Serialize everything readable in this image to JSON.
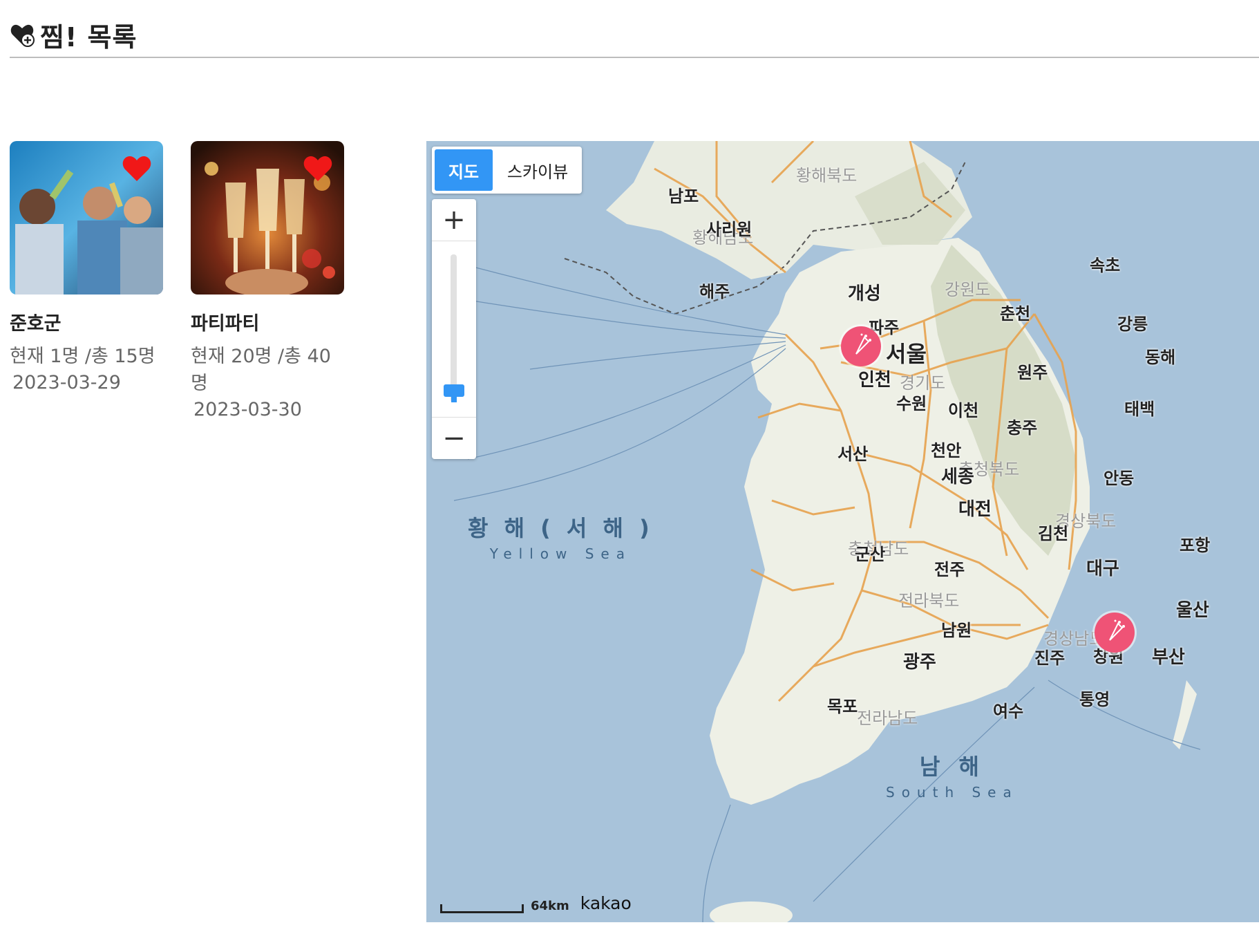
{
  "header": {
    "title": "찜! 목록"
  },
  "favorites": [
    {
      "name": "준호군",
      "count": "현재 1명 /총 15명",
      "date": "2023-03-29"
    },
    {
      "name": "파티파티",
      "count": "현재 20명 /총 40명",
      "date": "2023-03-30"
    }
  ],
  "map": {
    "type_map_label": "지도",
    "type_sky_label": "스카이뷰",
    "zoom_in_label": "+",
    "zoom_out_label": "−",
    "scale_label": "64km",
    "provider_label": "kakao",
    "sea_west": "황 해 ( 서 해 )",
    "sea_west_en": "Yellow Sea",
    "sea_south": "남 해",
    "sea_south_en": "South Sea",
    "cities": {
      "seoul": "서울",
      "incheon": "인천",
      "suwon": "수원",
      "icheon": "이천",
      "gaeseong": "개성",
      "paju": "파주",
      "chuncheon": "춘천",
      "gangneung": "강릉",
      "sokcho": "속초",
      "donghae": "동해",
      "wonju": "원주",
      "chungju": "충주",
      "cheonan": "천안",
      "sejong": "세종",
      "daejeon": "대전",
      "seosan": "서산",
      "gunsan": "군산",
      "jeonju": "전주",
      "gwangju": "광주",
      "mokpo": "목포",
      "yeosu": "여수",
      "namwon": "남원",
      "jinju": "진주",
      "changwon": "창원",
      "busan": "부산",
      "ulsan": "울산",
      "daegu": "대구",
      "pohang": "포항",
      "gimcheon": "김천",
      "andong": "안동",
      "taebaek": "태백",
      "tongyeong": "통영",
      "haeju": "해주",
      "sariwon": "사리원",
      "nampo": "남포"
    },
    "provinces": {
      "gyeonggi": "경기도",
      "gangwon": "강원도",
      "chungbuk": "충청북도",
      "chungnam": "충청남도",
      "jeonbuk": "전라북도",
      "jeonnam": "전라남도",
      "gyeongbuk": "경상북도",
      "gyeongnam": "경상남도",
      "hwanghaebuk": "황해북도",
      "hwanghaenam": "황해남도"
    },
    "colors": {
      "sea": "#a8c3da",
      "land": "#eef0e6",
      "road": "#e7a24e",
      "marker": "#ef5376",
      "accent": "#3296f5"
    }
  }
}
